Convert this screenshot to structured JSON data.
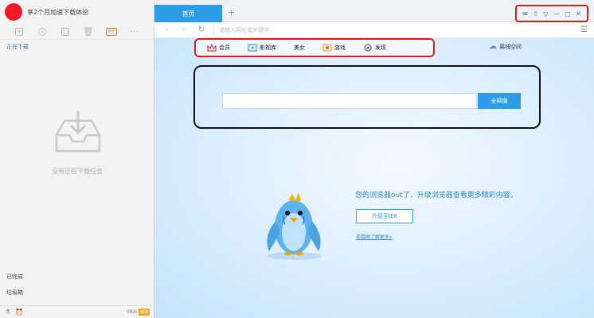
{
  "left_panel": {
    "promo_text": "享2个月加速下载体验",
    "toolbar": [
      "+",
      "i",
      "□",
      "🗑",
      "VIP",
      "···"
    ],
    "section_downloading": "正在下载",
    "empty_text": "没有正在下载任务",
    "finished_label": "已完成",
    "trash_label": "垃圾箱",
    "speed_text": "0B/s",
    "speed_badge": "加速"
  },
  "browser": {
    "tab_home": "首页",
    "tab_add": "+",
    "window_controls": [
      "✉",
      "⇧",
      "▽",
      "—",
      "□",
      "✕"
    ],
    "address_placeholder": "请输入网址或关键字",
    "menu_icon": "☰",
    "quicknav": [
      {
        "label": "会员",
        "icon": "crown-icon"
      },
      {
        "label": "影视库",
        "icon": "film-icon"
      },
      {
        "label": "美女",
        "icon": ""
      },
      {
        "label": "游戏",
        "icon": "game-icon"
      },
      {
        "label": "发现",
        "icon": "compass-icon"
      }
    ],
    "offline_label": "离线空间",
    "search_placeholder": "",
    "search_button": "全网搜",
    "outdated_text": "您的浏览器out了，升级浏览器查看更多精彩内容。",
    "upgrade_button": "升级至IE8",
    "learn_more": "查看网了解更多»"
  },
  "colors": {
    "accent": "#2d9de7",
    "highlight_red": "#d81e1e",
    "avatar_red": "#f01a24"
  }
}
